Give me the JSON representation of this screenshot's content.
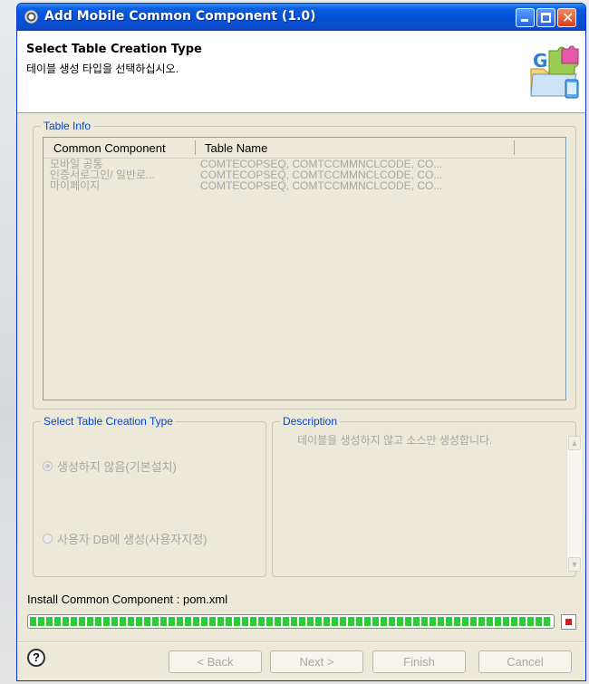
{
  "window": {
    "title": "Add Mobile Common Component (1.0)",
    "icons": {
      "app": "gear-icon",
      "minimize": "minimize-icon",
      "maximize": "maximize-icon",
      "close": "close-icon"
    }
  },
  "header": {
    "title": "Select Table Creation Type",
    "subtitle": "테이블 생성 타입을 선택하십시오.",
    "icon": "component-puzzle-icon"
  },
  "table_info": {
    "legend": "Table Info",
    "columns": [
      "Common Component",
      "Table Name"
    ],
    "rows": [
      [
        "모바일 공통",
        "COMTECOPSEQ, COMTCCMMNCLCODE, CO..."
      ],
      [
        "인증서로그인/ 일반로...",
        "COMTECOPSEQ, COMTCCMMNCLCODE, CO..."
      ],
      [
        "마이페이지",
        "COMTECOPSEQ, COMTCCMMNCLCODE, CO..."
      ]
    ]
  },
  "creation_type": {
    "legend": "Select Table Creation Type",
    "options": [
      {
        "label": "생성하지 않음(기본설치)",
        "selected": true
      },
      {
        "label": "사용자 DB에 생성(사용자지정)",
        "selected": false
      }
    ]
  },
  "description": {
    "legend": "Description",
    "text": "테이블을 생성하지 않고 소스만 생성합니다."
  },
  "install": {
    "label": "Install Common Component : pom.xml",
    "progress": 1.0
  },
  "buttons": {
    "back": "< Back",
    "next": "Next >",
    "finish": "Finish",
    "cancel": "Cancel",
    "help_icon": "help-icon"
  },
  "colors": {
    "titlebar": "#0550d8",
    "legend": "#0046d5",
    "progress": "#2fcc3a"
  }
}
